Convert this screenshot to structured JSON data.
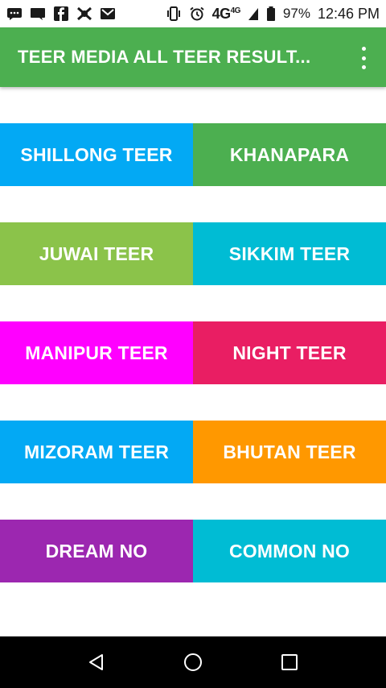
{
  "status_bar": {
    "icons_left": [
      "message-icon",
      "chat-icon",
      "facebook-icon",
      "app-icon",
      "gmail-icon"
    ],
    "icons_right": [
      "vibrate-icon",
      "alarm-icon",
      "battery-icon"
    ],
    "network": "4G",
    "network_sup": "4G",
    "battery": "97%",
    "time": "12:46 PM"
  },
  "app_bar": {
    "title": "TEER MEDIA ALL TEER RESULT...",
    "menu_icon": "more-vert-icon",
    "color": "#4caf50"
  },
  "tiles": [
    {
      "label": "SHILLONG TEER",
      "color": "#03a9f4"
    },
    {
      "label": "KHANAPARA",
      "color": "#4caf50"
    },
    {
      "label": "JUWAI TEER",
      "color": "#8bc34a"
    },
    {
      "label": "SIKKIM TEER",
      "color": "#00bcd4"
    },
    {
      "label": "MANIPUR TEER",
      "color": "#ff00ff"
    },
    {
      "label": "NIGHT TEER",
      "color": "#e91e63"
    },
    {
      "label": "MIZORAM TEER",
      "color": "#03a9f4"
    },
    {
      "label": "BHUTAN TEER",
      "color": "#ff9800"
    },
    {
      "label": "DREAM NO",
      "color": "#9c27b0"
    },
    {
      "label": "COMMON NO",
      "color": "#00bcd4"
    }
  ],
  "nav_bar": {
    "buttons": [
      "back-icon",
      "home-icon",
      "recents-icon"
    ]
  }
}
